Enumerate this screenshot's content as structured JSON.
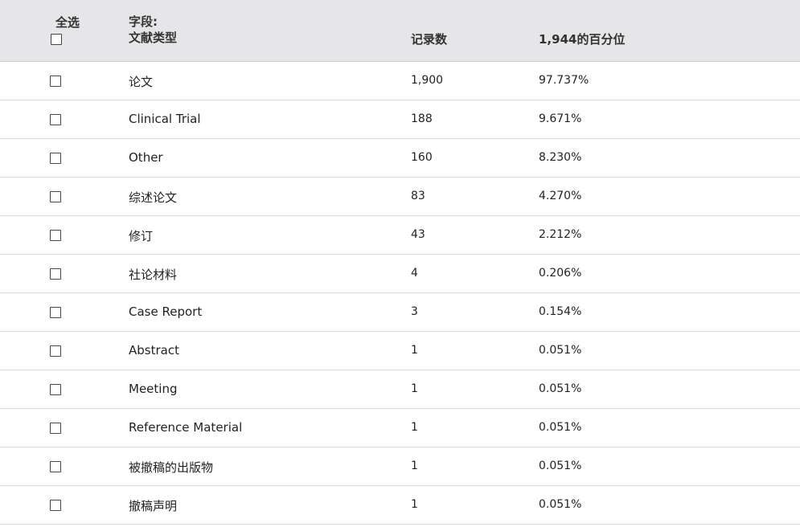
{
  "header": {
    "select_all_label": "全选",
    "field_label": "字段:",
    "field_name": "文献类型",
    "count_label": "记录数",
    "percent_label": "1,944的百分位"
  },
  "rows": [
    {
      "type": "论文",
      "count": "1,900",
      "percent": "97.737%"
    },
    {
      "type": "Clinical Trial",
      "count": "188",
      "percent": "9.671%"
    },
    {
      "type": "Other",
      "count": "160",
      "percent": "8.230%"
    },
    {
      "type": "综述论文",
      "count": "83",
      "percent": "4.270%"
    },
    {
      "type": "修订",
      "count": "43",
      "percent": "2.212%"
    },
    {
      "type": "社论材料",
      "count": "4",
      "percent": "0.206%"
    },
    {
      "type": "Case Report",
      "count": "3",
      "percent": "0.154%"
    },
    {
      "type": "Abstract",
      "count": "1",
      "percent": "0.051%"
    },
    {
      "type": "Meeting",
      "count": "1",
      "percent": "0.051%"
    },
    {
      "type": "Reference Material",
      "count": "1",
      "percent": "0.051%"
    },
    {
      "type": "被撤稿的出版物",
      "count": "1",
      "percent": "0.051%"
    },
    {
      "type": "撤稿声明",
      "count": "1",
      "percent": "0.051%"
    }
  ]
}
